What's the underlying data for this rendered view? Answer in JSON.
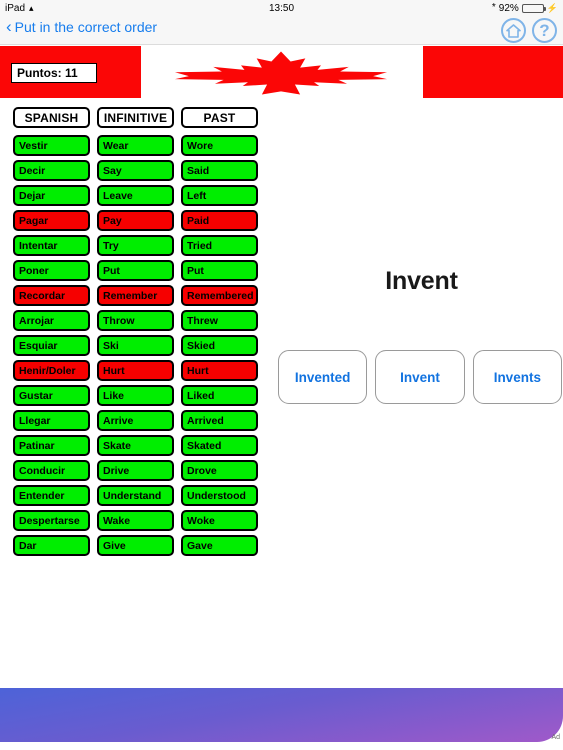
{
  "status_bar": {
    "device": "iPad",
    "wifi_icon": "wifi-icon",
    "time": "13:50",
    "bluetooth_icon": "bluetooth-icon",
    "battery_percent": "92%",
    "battery_icon": "battery-icon",
    "charging_icon": "charging-bolt-icon"
  },
  "nav_bar": {
    "back_label": "Put in the correct order",
    "back_chevron": "‹",
    "home_icon": "home-icon",
    "help_icon": "question-mark-icon"
  },
  "banner": {
    "flag_name": "canada-flag",
    "score_label": "Puntos: 11",
    "maple_leaf_icon": "maple-leaf-icon",
    "flag_red": "#fb0606"
  },
  "table": {
    "headers": [
      "SPANISH",
      "INFINITIVE",
      "PAST"
    ],
    "colors": {
      "correct": "#00ee00",
      "incorrect": "#f60000"
    },
    "rows": [
      {
        "spanish": "Vestir",
        "infinitive": "Wear",
        "past": "Wore",
        "state": "green"
      },
      {
        "spanish": "Decir",
        "infinitive": "Say",
        "past": "Said",
        "state": "green"
      },
      {
        "spanish": "Dejar",
        "infinitive": "Leave",
        "past": "Left",
        "state": "green"
      },
      {
        "spanish": "Pagar",
        "infinitive": "Pay",
        "past": "Paid",
        "state": "red"
      },
      {
        "spanish": "Intentar",
        "infinitive": "Try",
        "past": "Tried",
        "state": "green"
      },
      {
        "spanish": "Poner",
        "infinitive": "Put",
        "past": "Put",
        "state": "green"
      },
      {
        "spanish": "Recordar",
        "infinitive": "Remember",
        "past": "Remembered",
        "state": "red"
      },
      {
        "spanish": "Arrojar",
        "infinitive": "Throw",
        "past": "Threw",
        "state": "green"
      },
      {
        "spanish": "Esquiar",
        "infinitive": "Ski",
        "past": "Skied",
        "state": "green"
      },
      {
        "spanish": "Henir/Doler",
        "infinitive": "Hurt",
        "past": "Hurt",
        "state": "red"
      },
      {
        "spanish": "Gustar",
        "infinitive": "Like",
        "past": "Liked",
        "state": "green"
      },
      {
        "spanish": "Llegar",
        "infinitive": "Arrive",
        "past": "Arrived",
        "state": "green"
      },
      {
        "spanish": "Patinar",
        "infinitive": "Skate",
        "past": "Skated",
        "state": "green"
      },
      {
        "spanish": "Conducir",
        "infinitive": "Drive",
        "past": "Drove",
        "state": "green"
      },
      {
        "spanish": "Entender",
        "infinitive": "Understand",
        "past": "Understood",
        "state": "green"
      },
      {
        "spanish": "Despertarse",
        "infinitive": "Wake",
        "past": "Woke",
        "state": "green"
      },
      {
        "spanish": "Dar",
        "infinitive": "Give",
        "past": "Gave",
        "state": "green"
      }
    ]
  },
  "quiz": {
    "prompt": "Invent",
    "options": [
      "Invented",
      "Invent",
      "Invents"
    ],
    "option_color": "#1273e0"
  },
  "ad": {
    "label": "Ad",
    "gradient_start": "#4d63d8",
    "gradient_end": "#a059c9"
  }
}
